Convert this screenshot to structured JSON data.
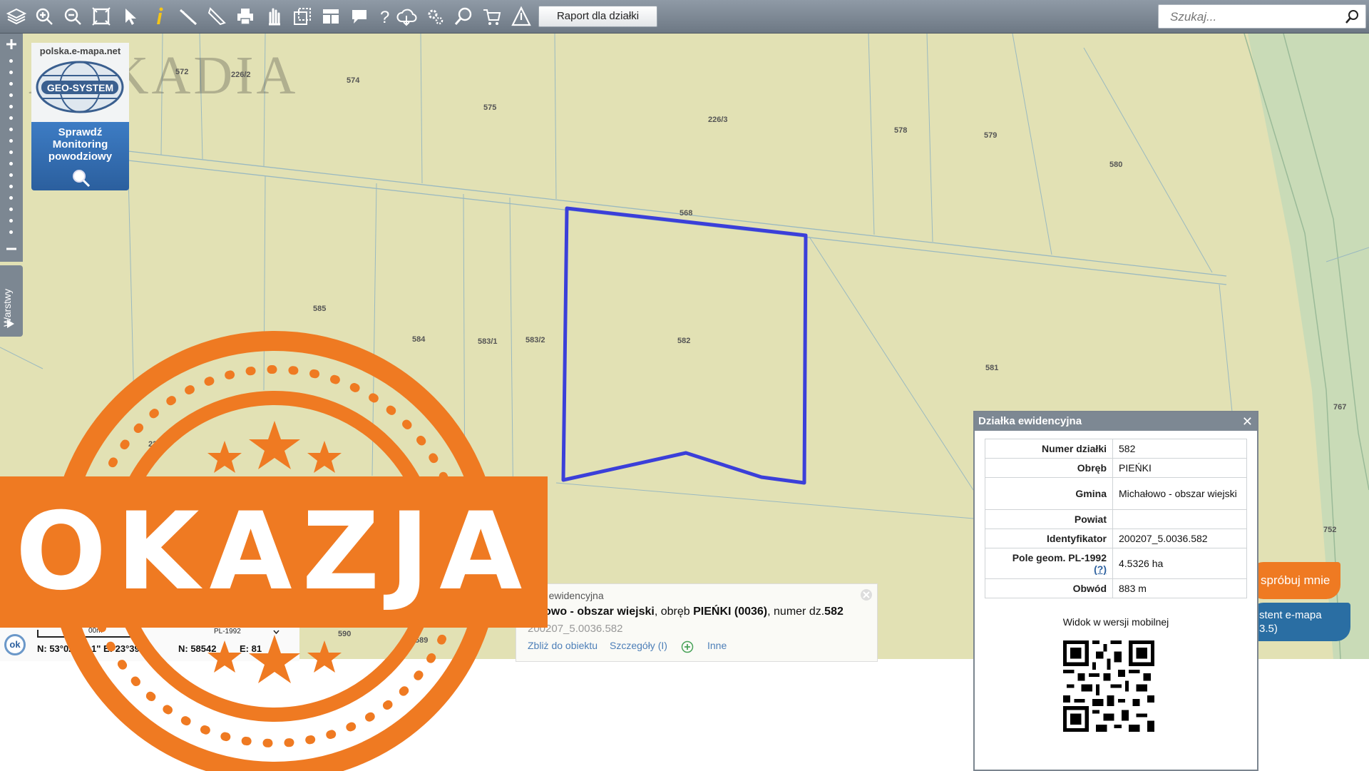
{
  "toolbar": {
    "report_button_label": "Raport dla działki",
    "search_placeholder": "Szukaj...",
    "icons": [
      "layers-icon",
      "zoom-in-icon",
      "zoom-out-icon",
      "zoom-extent-icon",
      "select-arrow-icon",
      "info-icon",
      "measure-distance-icon",
      "measure-area-icon",
      "print-icon",
      "pan-icon",
      "select-window-icon",
      "layout-icon",
      "comment-icon",
      "help-icon",
      "cloud-icon",
      "settings-icon",
      "search-map-icon",
      "cart-icon",
      "warning-icon"
    ]
  },
  "watermark": {
    "text": "ARKADIA"
  },
  "geo_banner": {
    "site": "polska.e-mapa.net",
    "logo_text": "GEO-SYSTEM",
    "promo_text": "Sprawdź Monitoring powodziowy"
  },
  "layers_tab": {
    "label": "Warstwy"
  },
  "parcels": [
    {
      "id": "p572",
      "label": "572"
    },
    {
      "id": "p226_2",
      "label": "226/2"
    },
    {
      "id": "p574",
      "label": "574"
    },
    {
      "id": "p575",
      "label": "575"
    },
    {
      "id": "p226_3",
      "label": "226/3"
    },
    {
      "id": "p578",
      "label": "578"
    },
    {
      "id": "p579",
      "label": "579"
    },
    {
      "id": "p580",
      "label": "580"
    },
    {
      "id": "p568",
      "label": "568"
    },
    {
      "id": "p585",
      "label": "585"
    },
    {
      "id": "p584",
      "label": "584"
    },
    {
      "id": "p583_1",
      "label": "583/1"
    },
    {
      "id": "p583_2",
      "label": "583/2"
    },
    {
      "id": "p582",
      "label": "582"
    },
    {
      "id": "p581",
      "label": "581"
    },
    {
      "id": "p767",
      "label": "767"
    },
    {
      "id": "p752",
      "label": "752"
    },
    {
      "id": "p226_x",
      "label": "226/"
    },
    {
      "id": "p590",
      "label": "590"
    },
    {
      "id": "p589",
      "label": "589"
    }
  ],
  "coords": {
    "ok_label": "ok",
    "scale_label": "00m",
    "crs_label": "PL-1992",
    "n1": "N: 53°02",
    "e1": "1\" E: 23°39'0",
    "n2": "N: 58542",
    "e2": "E: 81"
  },
  "info_popup": {
    "title": "ałka ewidencyjna",
    "desc_prefix": "hałowo - obszar wiejski",
    "desc_mid": ", obręb ",
    "desc_obreb": "PIEŃKI (0036)",
    "desc_mid2": ", numer dz.",
    "desc_num": "582",
    "identifier": "200207_5.0036.582",
    "link_zoom": "Zbliż do obiektu",
    "link_details": "Szczegóły (I)",
    "link_other": "Inne"
  },
  "parcel_panel": {
    "title": "Działka ewidencyjna",
    "rows": [
      {
        "key": "Numer działki",
        "value": "582"
      },
      {
        "key": "Obręb",
        "value": "PIEŃKI"
      },
      {
        "key": "Gmina",
        "value": "Michałowo - obszar wiejski"
      },
      {
        "key": "Powiat",
        "value": ""
      },
      {
        "key": "Identyfikator",
        "value": "200207_5.0036.582"
      },
      {
        "key": "Pole geom. PL-1992",
        "key_suffix": "(?)",
        "value": "4.5326 ha"
      },
      {
        "key": "Obwód",
        "value": "883 m"
      }
    ],
    "mobile_label": "Widok w wersji mobilnej"
  },
  "try_button": {
    "label": "spróbuj mnie"
  },
  "assistant_button": {
    "line1": "stent e-mapa",
    "line2": "3.5)"
  },
  "stamp": {
    "text": "OKAZJA"
  },
  "colors": {
    "map_bg": "#e2e1b4",
    "parcel_outline": "#3b3fd9",
    "stamp_orange": "#ef7a22",
    "toolbar": "#7c8792"
  }
}
